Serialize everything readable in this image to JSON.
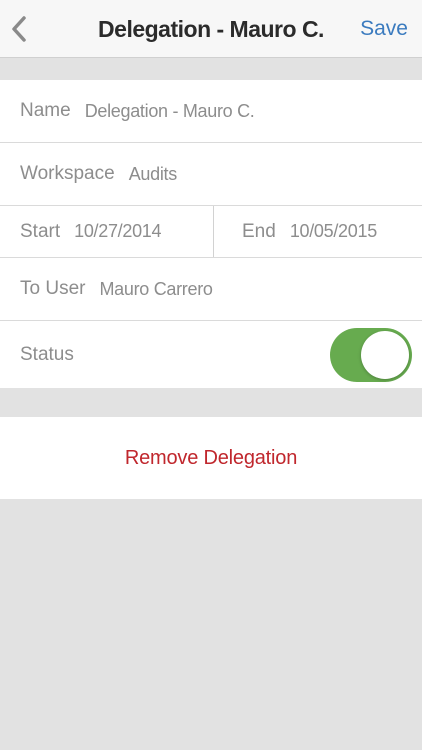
{
  "navbar": {
    "back_icon": "chevron-left-icon",
    "title": "Delegation - Mauro C.",
    "save_label": "Save",
    "accent_color": "#3b7bbf"
  },
  "form": {
    "name": {
      "label": "Name",
      "value": "Delegation - Mauro C."
    },
    "workspace": {
      "label": "Workspace",
      "value": "Audits"
    },
    "start": {
      "label": "Start",
      "value": "10/27/2014"
    },
    "end": {
      "label": "End",
      "value": "10/05/2015"
    },
    "to_user": {
      "label": "To User",
      "value": "Mauro Carrero"
    },
    "status": {
      "label": "Status",
      "enabled": true,
      "toggle_color": "#67ab4f"
    }
  },
  "actions": {
    "remove_label": "Remove Delegation",
    "remove_color": "#c0272d"
  }
}
